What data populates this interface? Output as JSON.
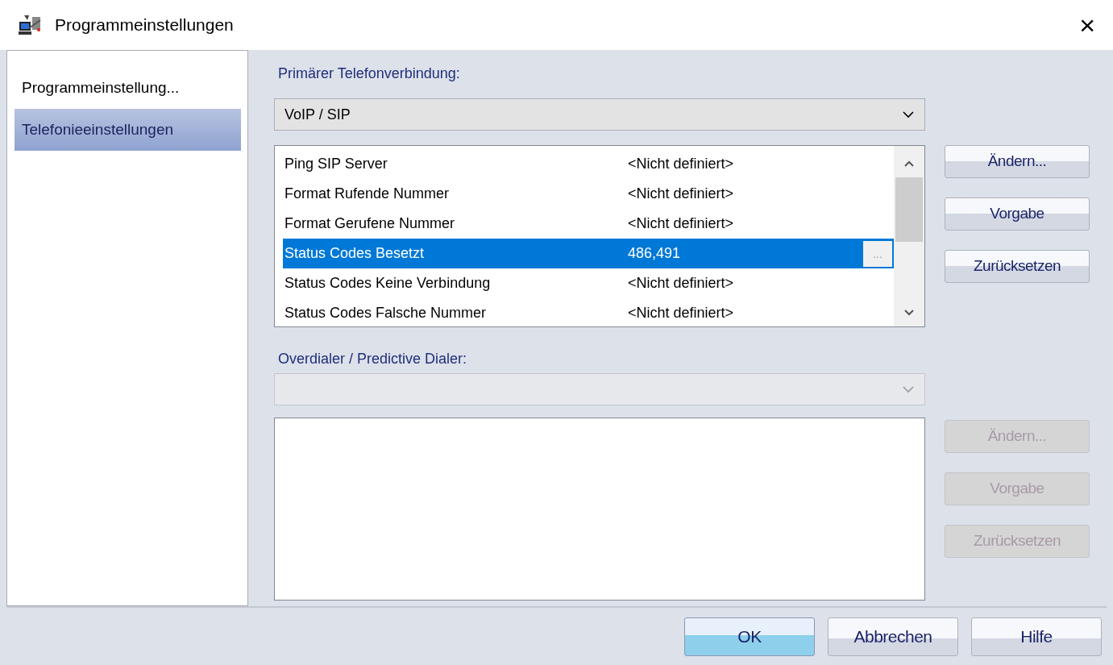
{
  "window": {
    "title": "Programmeinstellungen",
    "close": "×"
  },
  "sidebar": {
    "items": [
      {
        "label": "Programmeinstellung...",
        "selected": false
      },
      {
        "label": "Telefonieeinstellungen",
        "selected": true
      }
    ]
  },
  "primary": {
    "label": "Primärer Telefonverbindung:",
    "select": {
      "value": "VoIP / SIP",
      "disabled": false
    },
    "rows": [
      {
        "name": "Ping SIP Server",
        "value": "<Nicht definiert>",
        "selected": false
      },
      {
        "name": "Format Rufende Nummer",
        "value": "<Nicht definiert>",
        "selected": false
      },
      {
        "name": "Format Gerufene Nummer",
        "value": "<Nicht definiert>",
        "selected": false
      },
      {
        "name": "Status Codes Besetzt",
        "value": "486,491",
        "selected": true,
        "ellipsis": "..."
      },
      {
        "name": "Status Codes Keine Verbindung",
        "value": "<Nicht definiert>",
        "selected": false
      },
      {
        "name": "Status Codes Falsche Nummer",
        "value": "<Nicht definiert>",
        "selected": false
      }
    ],
    "buttons": [
      {
        "label": "Ändern...",
        "disabled": false
      },
      {
        "label": "Vorgabe",
        "disabled": false
      },
      {
        "label": "Zurücksetzen",
        "disabled": false
      }
    ]
  },
  "overdialer": {
    "label": "Overdialer / Predictive Dialer:",
    "select": {
      "disabled": true
    },
    "buttons": [
      {
        "label": "Ändern...",
        "disabled": true
      },
      {
        "label": "Vorgabe",
        "disabled": true
      },
      {
        "label": "Zurücksetzen",
        "disabled": true
      }
    ]
  },
  "footer": {
    "buttons": [
      {
        "label": "OK",
        "default": true
      },
      {
        "label": "Abbrechen",
        "default": false
      },
      {
        "label": "Hilfe",
        "default": false
      }
    ]
  }
}
